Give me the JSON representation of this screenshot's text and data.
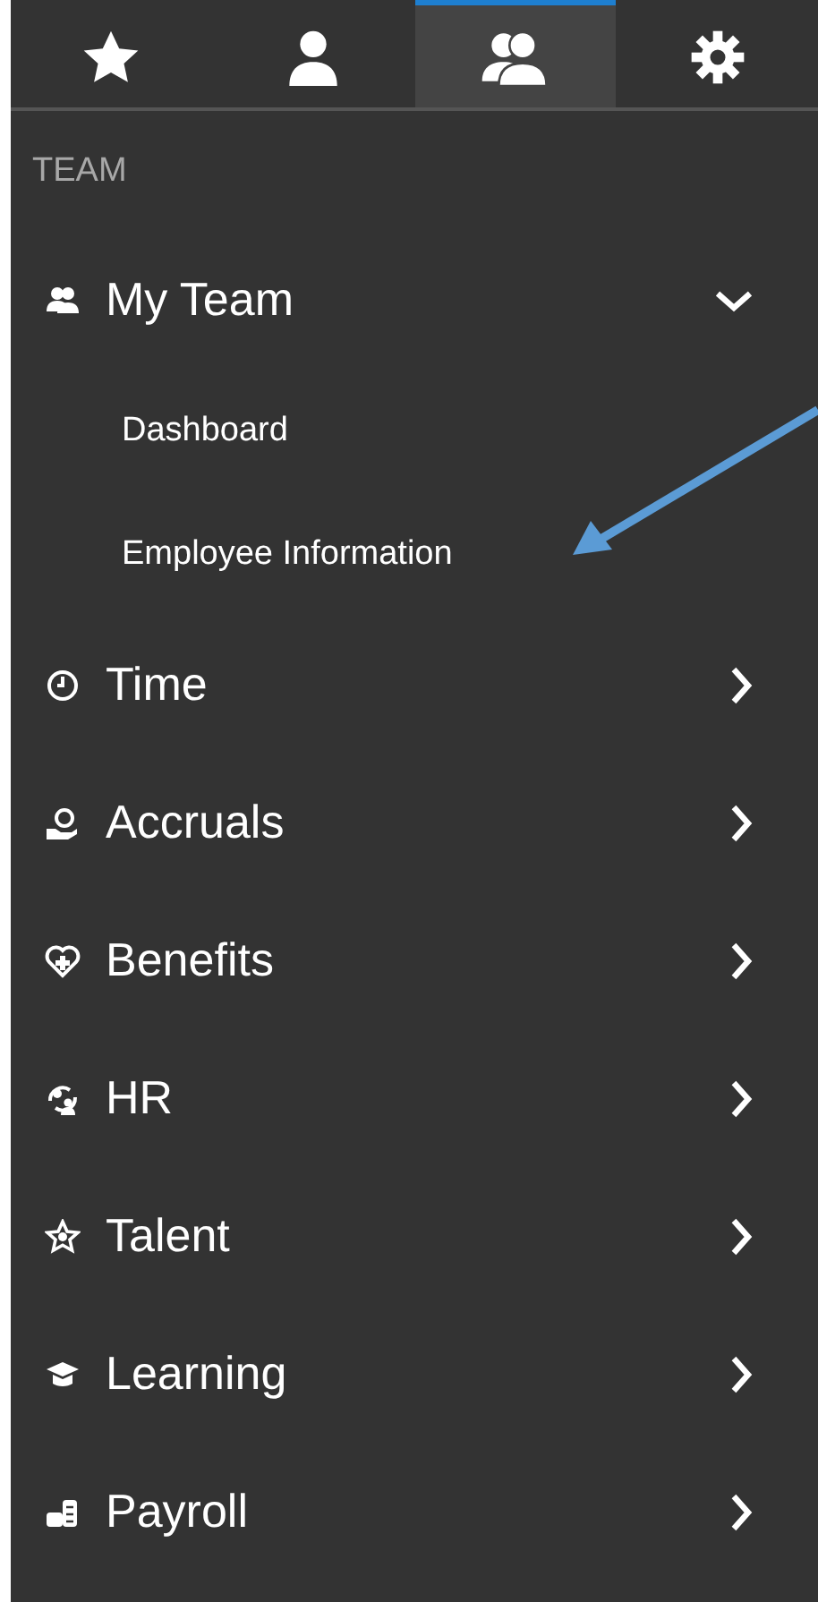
{
  "tabs": [
    {
      "selected": false
    },
    {
      "selected": false
    },
    {
      "selected": true
    },
    {
      "selected": false
    }
  ],
  "section": {
    "title": "TEAM"
  },
  "menu": [
    {
      "label": "My Team",
      "expanded": true,
      "children": [
        {
          "label": "Dashboard"
        },
        {
          "label": "Employee Information"
        }
      ]
    },
    {
      "label": "Time",
      "expanded": false
    },
    {
      "label": "Accruals",
      "expanded": false
    },
    {
      "label": "Benefits",
      "expanded": false
    },
    {
      "label": "HR",
      "expanded": false
    },
    {
      "label": "Talent",
      "expanded": false
    },
    {
      "label": "Learning",
      "expanded": false
    },
    {
      "label": "Payroll",
      "expanded": false
    }
  ]
}
